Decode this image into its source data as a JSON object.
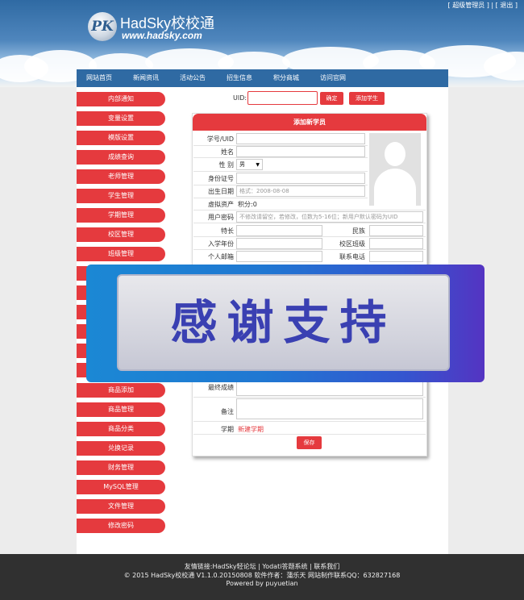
{
  "header": {
    "logo_mark": "PK",
    "site_title": "HadSky校校通",
    "site_url": "www.hadsky.com",
    "top_links": [
      "[ 超级管理员 ]",
      "[ 退出 ]"
    ]
  },
  "nav": [
    "网站首页",
    "新闻资讯",
    "活动公告",
    "招生信息",
    "积分商城",
    "访问官网"
  ],
  "sidebar": [
    "内部通知",
    "变量设置",
    "模版设置",
    "成绩查询",
    "老师管理",
    "学生管理",
    "学期管理",
    "校区管理",
    "班级管理",
    "商品添加",
    "商品管理",
    "商品分类",
    "兑换记录",
    "财务管理",
    "MySQL管理",
    "文件管理",
    "修改密码"
  ],
  "search": {
    "label": "UID:",
    "confirm_label": "确定",
    "add_label": "添加学生"
  },
  "form": {
    "title": "添加新学员",
    "uid_label": "学号/UID",
    "name_label": "姓名",
    "gender_label": "性 别",
    "gender_value": "男",
    "id_label": "身份证号",
    "birth_label": "出生日期",
    "birth_placeholder": "格式：2008-08-08",
    "assets_label": "虚拟资产",
    "assets_value": "积分:0",
    "password_label": "用户密码",
    "password_placeholder": "不修改请留空，若修改，位数为5-16位；新用户默认密码为UID",
    "specialty_label": "特长",
    "ethnic_label": "民族",
    "enroll_label": "入学年份",
    "campus_label": "校区班级",
    "email_label": "个人邮箱",
    "phone_label": "联系电话",
    "final_label": "最终成绩",
    "remark_label": "备注",
    "term_label": "学期",
    "term_link": "新建学期",
    "save_label": "保存"
  },
  "banner_text": "感谢支持",
  "footer": {
    "links": "友情链接:HadSky轻论坛 | Yodati答题系统 | 联系我们",
    "copyright": "© 2015 HadSky校校通 V1.1.0.20150808 软件作者：蒲乐天 网站制作联系QQ：632827168",
    "powered": "Powered by puyuetian"
  },
  "colors": {
    "accent": "#e53a3e",
    "nav": "#2f6aa3",
    "footer": "#303030"
  }
}
